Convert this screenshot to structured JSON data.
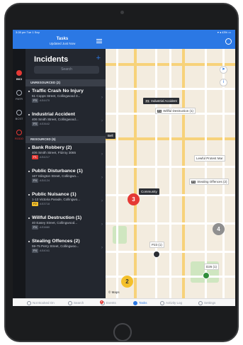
{
  "status": {
    "time": "3:28 pm  Tue 1 Sep",
    "battery": "▾ ◂ 43% ▭"
  },
  "header": {
    "title": "Tasks",
    "subtitle": "Updated Just Now"
  },
  "rail": [
    {
      "label": "INCI",
      "active": true
    },
    {
      "label": "PATR"
    },
    {
      "label": "BCST"
    },
    {
      "label": "RODO"
    }
  ],
  "panel": {
    "title": "Incidents",
    "add": "+",
    "search_placeholder": "Search",
    "sections": [
      {
        "label": "UNRESOURCED (2)"
      },
      {
        "label": "RESOURCED (5)"
      }
    ],
    "incidents": [
      {
        "title": "Traffic Crash No Injury",
        "address": "61 Copps Street, Collingwood 3...",
        "priority": "P3",
        "id": "AS4470"
      },
      {
        "title": "Industrial Accident",
        "address": "406 Smith Street, Collingwood...",
        "priority": "P3",
        "id": "AS3642"
      },
      {
        "title": "Bank Robbery (2)",
        "address": "406 Smith Street, Fitzroy 3065",
        "priority": "P1",
        "id": "AS4217"
      },
      {
        "title": "Public Disturbance (1)",
        "address": "167 Islington Street, Collingwo...",
        "priority": "P4",
        "id": "AS4124"
      },
      {
        "title": "Public Nuisance (1)",
        "address": "1-13 Victoria Parade, Collingwo...",
        "priority": "P2",
        "id": "AS3718"
      },
      {
        "title": "Willful Destruction (1)",
        "address": "40 Easey Street, Collingwood...",
        "priority": "P4",
        "id": "AS3880"
      },
      {
        "title": "Stealing Offences (2)",
        "address": "59-75 Perry Street, Collingwoo...",
        "priority": "P4",
        "id": "AS4041"
      }
    ]
  },
  "map": {
    "labels": [
      {
        "text": "Industrial Accident",
        "prio": "P3",
        "dark": true
      },
      {
        "text": "Willful Destruction (1)",
        "prio": "P4"
      },
      {
        "text": "Lewful Protest Mar"
      },
      {
        "text": "Stealing Offences (2)",
        "prio": "P4"
      },
      {
        "text": "Community",
        "dark": true
      },
      {
        "text": "Bell",
        "dark": true
      },
      {
        "text": "P23 (1)"
      },
      {
        "text": "D26 (1)"
      }
    ],
    "clusters": [
      "3",
      "2",
      "4"
    ],
    "logo": "© Maps"
  },
  "tabs": [
    {
      "label": "Not Booked On"
    },
    {
      "label": "Search"
    },
    {
      "label": "Events",
      "badge": "8"
    },
    {
      "label": "Tasks",
      "active": true
    },
    {
      "label": "Activity Log"
    },
    {
      "label": "Settings"
    }
  ],
  "colors": {
    "accent": "#2b78e4",
    "panel": "#23272f",
    "alert": "#e53935",
    "p2": "#f4c02b"
  }
}
